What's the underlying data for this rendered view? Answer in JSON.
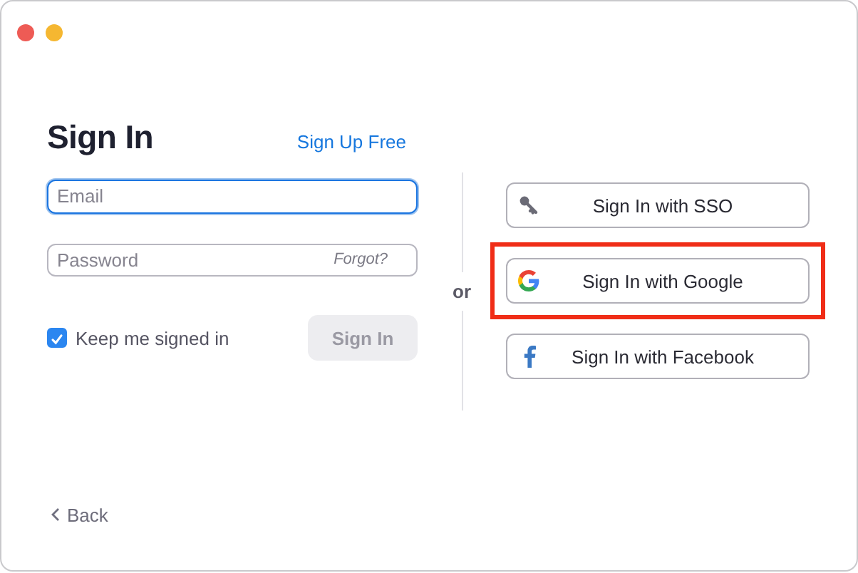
{
  "window": {
    "controls": [
      {
        "kind": "close"
      },
      {
        "kind": "minimize"
      }
    ]
  },
  "title": "Sign In",
  "signup_link": "Sign Up Free",
  "email": {
    "placeholder": "Email",
    "focused": true
  },
  "password": {
    "placeholder": "Password",
    "forgot_link": "Forgot?"
  },
  "keep_signed_in": {
    "label": "Keep me signed in",
    "checked": true
  },
  "sign_in_button": {
    "label": "Sign In",
    "disabled": true
  },
  "separator": "or",
  "providers": [
    {
      "kind": "sso",
      "label": "Sign In with SSO",
      "highlighted": false
    },
    {
      "kind": "google",
      "label": "Sign In with Google",
      "highlighted": true
    },
    {
      "kind": "facebook",
      "label": "Sign In with Facebook",
      "highlighted": false
    }
  ],
  "back_link": "Back"
}
